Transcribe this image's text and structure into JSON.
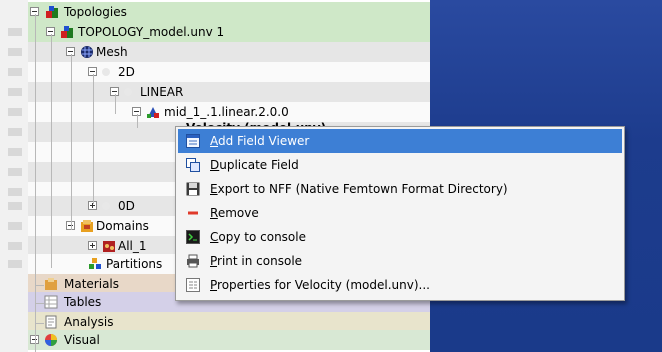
{
  "tree": {
    "topologies": "Topologies",
    "topology_model": "TOPOLOGY_model.unv 1",
    "mesh": "Mesh",
    "node_2d": "2D",
    "linear": "LINEAR",
    "mid_linear": "mid_1_.1.linear.2.0.0",
    "velocity": "Velocity (model.unv)",
    "node_0d": "0D",
    "domains": "Domains",
    "all_1": "All_1",
    "partitions": "Partitions",
    "materials": "Materials",
    "tables": "Tables",
    "analysis": "Analysis",
    "visual": "Visual"
  },
  "context_menu": {
    "items": [
      {
        "first": "A",
        "rest": "dd Field Viewer",
        "icon": "field-viewer-icon"
      },
      {
        "first": "D",
        "rest": "uplicate Field",
        "icon": "duplicate-icon"
      },
      {
        "first": "E",
        "rest": "xport to NFF (Native Femtown Format Directory)",
        "icon": "save-icon"
      },
      {
        "first": "R",
        "rest": "emove",
        "icon": "remove-icon"
      },
      {
        "first": "C",
        "rest": "opy to console",
        "icon": "console-icon"
      },
      {
        "first": "P",
        "rest": "rint in console",
        "icon": "print-icon"
      },
      {
        "first": "P",
        "rest": "roperties for Velocity (model.unv)...",
        "icon": "properties-icon"
      }
    ]
  },
  "colors": {
    "highlight": "#3d7fd5",
    "topologies_band": "#cfe8c8",
    "materials_band": "#e8d8c8",
    "tables_band": "#d4d0e8",
    "analysis_band": "#e8e4cc",
    "visual_band": "#d8e8d4",
    "view_background": "#1f3f8f"
  }
}
